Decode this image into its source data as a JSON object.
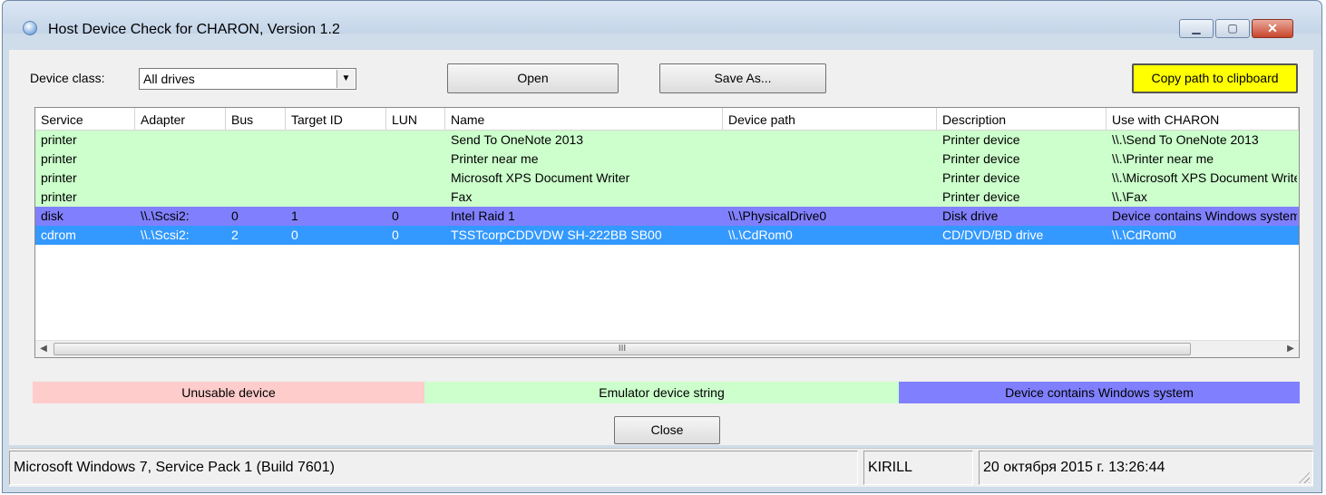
{
  "window": {
    "title": "Host Device Check for CHARON, Version 1.2",
    "minimize_glyph": "▁",
    "maximize_glyph": "▢",
    "close_glyph": "✕"
  },
  "toolbar": {
    "device_class_label": "Device class:",
    "device_class_value": "All drives",
    "dropdown_glyph": "▼",
    "open_label": "Open",
    "save_as_label": "Save As...",
    "copy_label": "Copy path to clipboard"
  },
  "table": {
    "columns": [
      "Service",
      "Adapter",
      "Bus",
      "Target ID",
      "LUN",
      "Name",
      "Device path",
      "Description",
      "Use with CHARON"
    ],
    "rows": [
      {
        "cells": [
          "printer",
          "",
          "",
          "",
          "",
          "Send To OneNote 2013",
          "",
          "Printer device",
          "\\\\.\\Send To OneNote 2013"
        ],
        "bg": "#ccffcc",
        "fg": "#000000"
      },
      {
        "cells": [
          "printer",
          "",
          "",
          "",
          "",
          "Printer near me",
          "",
          "Printer device",
          "\\\\.\\Printer near me"
        ],
        "bg": "#ccffcc",
        "fg": "#000000"
      },
      {
        "cells": [
          "printer",
          "",
          "",
          "",
          "",
          "Microsoft XPS Document Writer",
          "",
          "Printer device",
          "\\\\.\\Microsoft XPS Document Writer"
        ],
        "bg": "#ccffcc",
        "fg": "#000000"
      },
      {
        "cells": [
          "printer",
          "",
          "",
          "",
          "",
          "Fax",
          "",
          "Printer device",
          "\\\\.\\Fax"
        ],
        "bg": "#ccffcc",
        "fg": "#000000"
      },
      {
        "cells": [
          "disk",
          "\\\\.\\Scsi2:",
          "0",
          "1",
          "0",
          "Intel Raid 1",
          "\\\\.\\PhysicalDrive0",
          "Disk drive",
          "Device contains Windows system"
        ],
        "bg": "#8080ff",
        "fg": "#000000"
      },
      {
        "cells": [
          "cdrom",
          "\\\\.\\Scsi2:",
          "2",
          "0",
          "0",
          "TSSTcorpCDDVDW SH-222BB SB00",
          "\\\\.\\CdRom0",
          "CD/DVD/BD drive",
          "\\\\.\\CdRom0"
        ],
        "bg": "#3399ff",
        "fg": "#ffffff"
      }
    ],
    "scroll_left_glyph": "◀",
    "scroll_right_glyph": "▶",
    "scroll_thumb_glyph": "III"
  },
  "legend": {
    "unusable": "Unusable device",
    "emulator": "Emulator device string",
    "windows_system": "Device contains Windows system",
    "colors": {
      "unusable": "#ffcccc",
      "emulator": "#ccffcc",
      "windows_system": "#8080ff",
      "selected": "#3399ff"
    }
  },
  "close_label": "Close",
  "statusbar": {
    "os": "Microsoft Windows 7, Service Pack 1 (Build 7601)",
    "user": "KIRILL",
    "datetime": "20 октября 2015 г. 13:26:44"
  }
}
